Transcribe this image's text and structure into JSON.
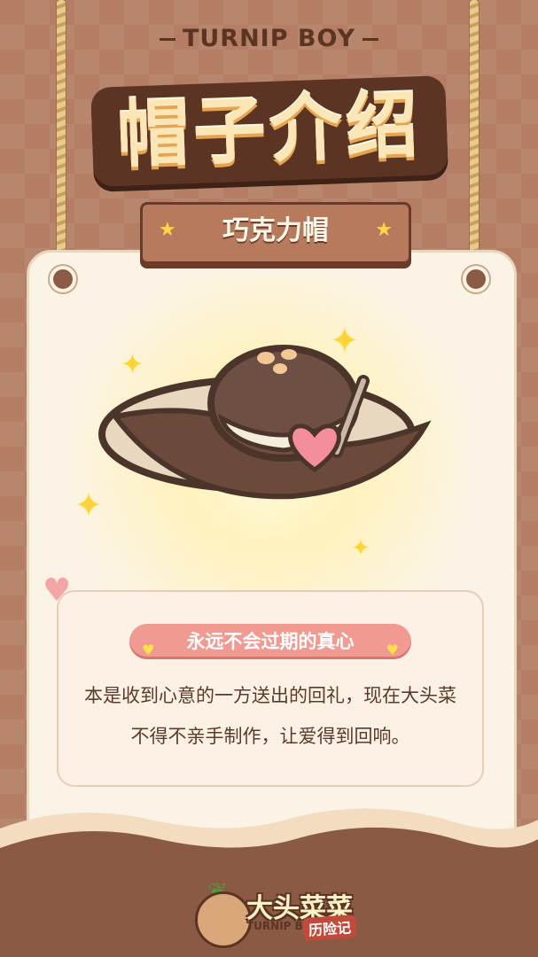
{
  "header": {
    "brand": "TURNIP BOY",
    "title": "帽子介绍"
  },
  "ribbon": {
    "hat_name": "巧克力帽"
  },
  "info": {
    "tagline": "永远不会过期的真心",
    "description": "本是收到心意的一方送出的回礼，现在大头菜不得不亲手制作，让爱得到回响。"
  },
  "logo": {
    "name_cn": "大头菜菜",
    "name_en": "TURNIP BOY",
    "subtitle": "历险记"
  },
  "colors": {
    "background": "#b47d64",
    "card": "#fbf4e6",
    "tag": "#f09a91",
    "title_text": "#fbe6b8",
    "dark_brown": "#5b3424"
  },
  "icons": [
    "star-icon",
    "heart-icon",
    "sparkle-icon",
    "turnip-icon",
    "leaf-icon"
  ]
}
